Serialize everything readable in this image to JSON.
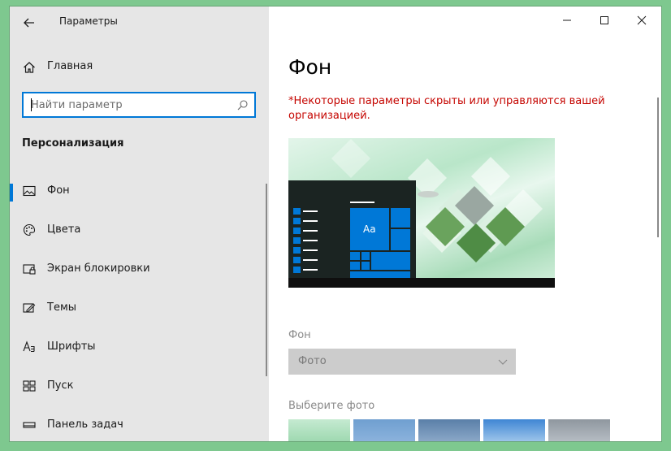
{
  "window": {
    "title": "Параметры",
    "controls": [
      "minimize-icon",
      "maximize-icon",
      "close-icon"
    ]
  },
  "sidebar": {
    "home_label": "Главная",
    "search_placeholder": "Найти параметр",
    "section_title": "Персонализация",
    "items": [
      {
        "label": "Фон",
        "icon": "picture-icon",
        "active": true
      },
      {
        "label": "Цвета",
        "icon": "palette-icon",
        "active": false
      },
      {
        "label": "Экран блокировки",
        "icon": "lock-screen-icon",
        "active": false
      },
      {
        "label": "Темы",
        "icon": "themes-icon",
        "active": false
      },
      {
        "label": "Шрифты",
        "icon": "fonts-icon",
        "active": false
      },
      {
        "label": "Пуск",
        "icon": "start-icon",
        "active": false
      },
      {
        "label": "Панель задач",
        "icon": "taskbar-icon",
        "active": false
      }
    ]
  },
  "main": {
    "title": "Фон",
    "warning": "*Некоторые параметры скрыты или управляются вашей организацией.",
    "preview": {
      "tile_text": "Aa"
    },
    "background_label": "Фон",
    "background_value": "Фото",
    "choose_photo_label": "Выберите фото"
  },
  "colors": {
    "accent": "#0078d7",
    "warning": "#c50500",
    "sidebar_bg": "#e6e6e6"
  }
}
